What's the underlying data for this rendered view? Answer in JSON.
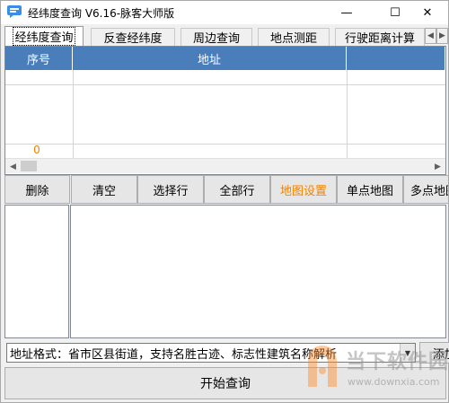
{
  "window": {
    "title": "经纬度查询 V6.16-脉客大师版",
    "controls": {
      "minimize": "—",
      "maximize": "☐",
      "close": "✕"
    }
  },
  "tabs": [
    {
      "label": "经纬度查询",
      "active": true
    },
    {
      "label": "反查经纬度",
      "active": false
    },
    {
      "label": "周边查询",
      "active": false
    },
    {
      "label": "地点测距",
      "active": false
    },
    {
      "label": "行驶距离计算",
      "active": false
    }
  ],
  "tab_scroll": {
    "left": "◀",
    "right": "▶"
  },
  "table": {
    "columns": [
      "序号",
      "地址",
      ""
    ],
    "row_count": "0",
    "scroll_left": "◀",
    "scroll_right": "▶"
  },
  "toolbar": {
    "buttons": [
      {
        "label": "删除"
      },
      {
        "label": "清空"
      },
      {
        "label": "选择行"
      },
      {
        "label": "全部行"
      },
      {
        "label": "地图设置",
        "color": "#f08300"
      },
      {
        "label": "单点地图"
      },
      {
        "label": "多点地图"
      }
    ]
  },
  "address_input": {
    "value": "地址格式：省市区县街道，支持名胜古迹、标志性建筑名称解析",
    "dropdown_icon": "▼"
  },
  "add_button": {
    "label": "添加"
  },
  "start_button": {
    "label": "开始查询"
  },
  "watermark": {
    "name": "当下软件园",
    "url": "www.downxia.com"
  },
  "colors": {
    "header_blue": "#4a7ebb",
    "accent_orange": "#f08300"
  }
}
